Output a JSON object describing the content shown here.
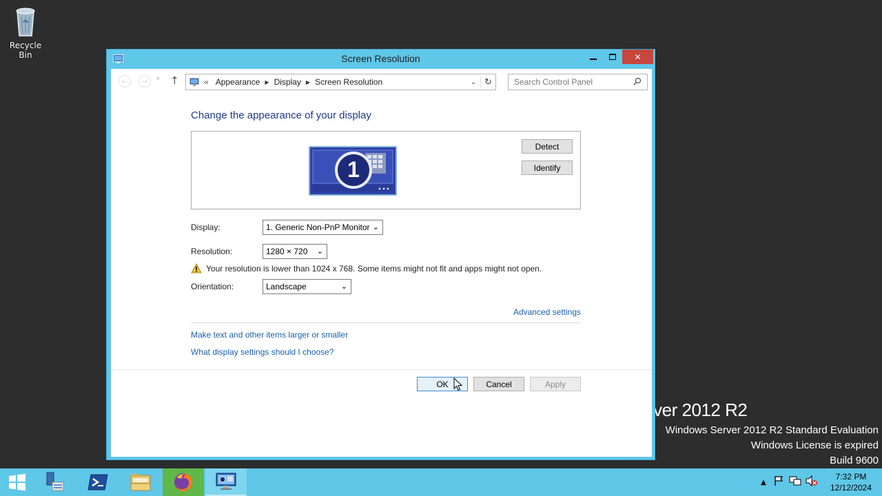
{
  "desktop": {
    "recycle_bin_label": "Recycle Bin",
    "watermark_big": "rver 2012 R2",
    "watermark_line1": "Windows Server 2012 R2 Standard Evaluation",
    "watermark_line2": "Windows License is expired",
    "watermark_line3": "Build 9600"
  },
  "window": {
    "title": "Screen Resolution",
    "close_glyph": "✕",
    "min_glyph": "▬",
    "max_glyph": "☐"
  },
  "address": {
    "prefix": "«",
    "crumbs": [
      "Appearance",
      "Display",
      "Screen Resolution"
    ],
    "search_placeholder": "Search Control Panel"
  },
  "main": {
    "heading": "Change the appearance of your display",
    "monitor_number": "1",
    "detect_label": "Detect",
    "identify_label": "Identify",
    "display_label": "Display:",
    "display_value": "1. Generic Non-PnP Monitor",
    "resolution_label": "Resolution:",
    "resolution_value": "1280 × 720",
    "warning_text": "Your resolution is lower than 1024 x 768. Some items might not fit and apps might not open.",
    "orientation_label": "Orientation:",
    "orientation_value": "Landscape",
    "advanced_link": "Advanced settings",
    "link_larger": "Make text and other items larger or smaller",
    "link_choose": "What display settings should I choose?"
  },
  "buttons": {
    "ok": "OK",
    "cancel": "Cancel",
    "apply": "Apply"
  },
  "taskbar": {
    "time": "7:32 PM",
    "date": "12/12/2024"
  },
  "colors": {
    "accent": "#5fc7e8",
    "close": "#c7463d",
    "link": "#1a5fae",
    "heading": "#1e3a8a"
  }
}
